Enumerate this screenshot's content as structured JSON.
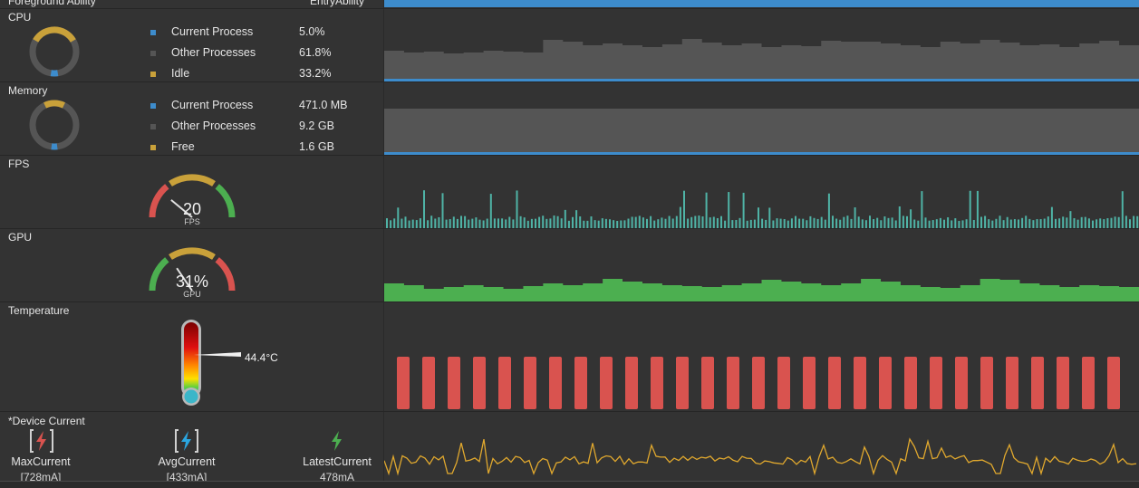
{
  "header": {
    "left_label": "Foreground Ability",
    "right_label": "EntryAbility"
  },
  "cpu": {
    "title": "CPU",
    "legend": [
      {
        "label": "Current Process",
        "value": "5.0%",
        "color": "#3d8ccc"
      },
      {
        "label": "Other Processes",
        "value": "61.8%",
        "color": "#555555"
      },
      {
        "label": "Idle",
        "value": "33.2%",
        "color": "#c9a13a"
      }
    ],
    "fractions": [
      0.05,
      0.618,
      0.332
    ]
  },
  "memory": {
    "title": "Memory",
    "legend": [
      {
        "label": "Current Process",
        "value": "471.0 MB",
        "color": "#3d8ccc"
      },
      {
        "label": "Other Processes",
        "value": "9.2 GB",
        "color": "#555555"
      },
      {
        "label": "Free",
        "value": "1.6 GB",
        "color": "#c9a13a"
      }
    ],
    "fractions": [
      0.042,
      0.815,
      0.143
    ]
  },
  "fps": {
    "title": "FPS",
    "value": "20",
    "unit": "FPS",
    "level": 0.22
  },
  "gpu": {
    "title": "GPU",
    "value": "31%",
    "unit": "GPU",
    "level": 0.31
  },
  "temperature": {
    "title": "Temperature",
    "value": "44.4°C"
  },
  "current": {
    "title": "*Device Current",
    "items": [
      {
        "label": "MaxCurrent",
        "value": "[728mA]",
        "icon": "max-current-icon",
        "color": "#d9534f"
      },
      {
        "label": "AvgCurrent",
        "value": "[433mA]",
        "icon": "avg-current-icon",
        "color": "#2aa6e0"
      },
      {
        "label": "LatestCurrent",
        "value": "478mA",
        "icon": "latest-current-icon",
        "color": "#4caf50"
      }
    ]
  },
  "colors": {
    "accent_blue": "#3d8ccc",
    "other_gray": "#555555",
    "idle_gold": "#c9a13a",
    "fps_teal": "#4fb3a6",
    "gpu_green": "#4caf50",
    "temp_red": "#d9534f",
    "current_yellow": "#e0a82e"
  }
}
